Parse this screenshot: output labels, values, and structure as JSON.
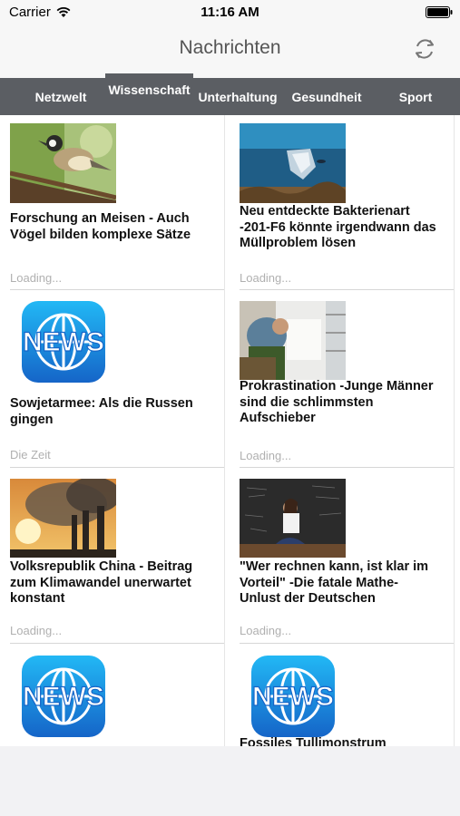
{
  "status_bar": {
    "carrier": "Carrier",
    "time": "11:16 AM"
  },
  "nav": {
    "title": "Nachrichten",
    "refresh_icon": "refresh-icon"
  },
  "tabs": [
    {
      "label": "Netzwelt"
    },
    {
      "label": "Wissenschaft",
      "active": true
    },
    {
      "label": "Unterhaltung"
    },
    {
      "label": "Gesundheit"
    },
    {
      "label": "Sport"
    }
  ],
  "articles": [
    {
      "title": "Forschung an Meisen - Auch Vögel bilden komplexe Sätze",
      "source": "Loading...",
      "image": "bird-photo"
    },
    {
      "title": "Neu entdeckte Bakterienart -201-F6 könnte irgendwann das Müllproblem lösen",
      "source": "Loading...",
      "image": "ocean-plastic-photo"
    },
    {
      "title": "Sowjetarmee: Als die Russen gingen",
      "source": "Die Zeit",
      "image": "news-app-icon"
    },
    {
      "title": "Prokrastination -Junge Männer sind die schlimmsten Aufschieber",
      "source": "Loading...",
      "image": "refrigerator-photo"
    },
    {
      "title": "Volksrepublik China - Beitrag zum Klimawandel unerwartet konstant",
      "source": "Loading...",
      "image": "smokestack-photo"
    },
    {
      "title": "\"Wer rechnen kann, ist klar im Vorteil\" -Die fatale Mathe-Unlust der Deutschen",
      "source": "Loading...",
      "image": "chalkboard-photo"
    },
    {
      "title": "",
      "source": "",
      "image": "news-app-icon"
    },
    {
      "title": "Fossiles Tullimonstrum",
      "source": "",
      "image": "news-app-icon"
    }
  ],
  "news_icon_text": "NEWS"
}
